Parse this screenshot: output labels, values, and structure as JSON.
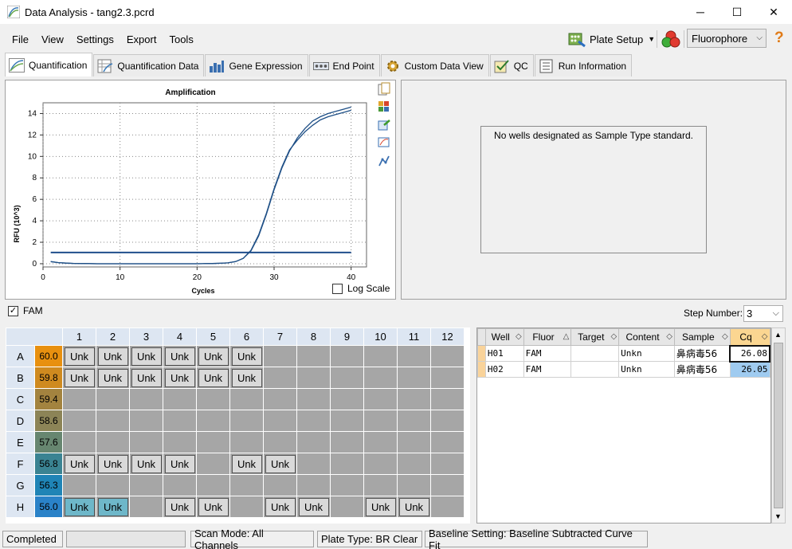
{
  "window": {
    "title": "Data Analysis - tang2.3.pcrd",
    "min": "─",
    "max": "☐",
    "close": "✕"
  },
  "menu": [
    "File",
    "View",
    "Settings",
    "Export",
    "Tools"
  ],
  "toolbar": {
    "plate_setup": "Plate Setup",
    "fluorophore": "Fluorophore",
    "help": "?"
  },
  "tabs": [
    "Quantification",
    "Quantification Data",
    "Gene Expression",
    "End Point",
    "Custom Data View",
    "QC",
    "Run Information"
  ],
  "amplification": {
    "title": "Amplification",
    "xlabel": "Cycles",
    "ylabel": "RFU (10^3)",
    "log_scale_label": "Log Scale",
    "threshold": 1.05,
    "chart_data": {
      "type": "line",
      "title": "Amplification",
      "xlabel": "Cycles",
      "ylabel": "RFU (10^3)",
      "xlim": [
        0,
        42
      ],
      "ylim": [
        -0.3,
        15
      ],
      "xticks": [
        0,
        10,
        20,
        30,
        40
      ],
      "yticks": [
        0,
        2,
        4,
        6,
        8,
        10,
        12,
        14
      ],
      "x": [
        1,
        2,
        3,
        4,
        5,
        6,
        7,
        8,
        9,
        10,
        11,
        12,
        13,
        14,
        15,
        16,
        17,
        18,
        19,
        20,
        21,
        22,
        23,
        24,
        25,
        26,
        27,
        28,
        29,
        30,
        31,
        32,
        33,
        34,
        35,
        36,
        37,
        38,
        39,
        40
      ],
      "series": [
        {
          "values": [
            0.2,
            0.1,
            0.06,
            0.03,
            0.02,
            0.01,
            0,
            0,
            0,
            0,
            0,
            0,
            0,
            0,
            0,
            0,
            0,
            0,
            0,
            0,
            0.01,
            0.02,
            0.04,
            0.08,
            0.2,
            0.5,
            1.2,
            2.6,
            4.6,
            6.9,
            8.9,
            10.5,
            11.7,
            12.6,
            13.3,
            13.7,
            14.0,
            14.2,
            14.4,
            14.6
          ]
        },
        {
          "values": [
            0.2,
            0.1,
            0.06,
            0.03,
            0.02,
            0.01,
            0,
            0,
            0,
            0,
            0,
            0,
            0,
            0,
            0,
            0,
            0,
            0,
            0,
            0,
            0.01,
            0.02,
            0.04,
            0.08,
            0.2,
            0.5,
            1.25,
            2.7,
            4.7,
            7.0,
            9.0,
            10.6,
            11.5,
            12.3,
            12.9,
            13.4,
            13.7,
            13.9,
            14.1,
            14.3
          ]
        }
      ]
    }
  },
  "standard_panel": {
    "message": "No wells designated as Sample Type standard."
  },
  "fam_checkbox": {
    "label": "FAM",
    "checked": true
  },
  "step_number": {
    "label": "Step Number:",
    "value": "3"
  },
  "plate": {
    "columns": [
      "1",
      "2",
      "3",
      "4",
      "5",
      "6",
      "7",
      "8",
      "9",
      "10",
      "11",
      "12"
    ],
    "rows": [
      {
        "label": "A",
        "temp": "60.0",
        "color": "#e8900f",
        "wells": [
          "Unk",
          "Unk",
          "Unk",
          "Unk",
          "Unk",
          "Unk",
          "",
          "",
          "",
          "",
          "",
          ""
        ]
      },
      {
        "label": "B",
        "temp": "59.8",
        "color": "#cf8a1f",
        "wells": [
          "Unk",
          "Unk",
          "Unk",
          "Unk",
          "Unk",
          "Unk",
          "",
          "",
          "",
          "",
          "",
          ""
        ]
      },
      {
        "label": "C",
        "temp": "59.4",
        "color": "#a3833f",
        "wells": [
          "",
          "",
          "",
          "",
          "",
          "",
          "",
          "",
          "",
          "",
          "",
          ""
        ]
      },
      {
        "label": "D",
        "temp": "58.6",
        "color": "#8c8457",
        "wells": [
          "",
          "",
          "",
          "",
          "",
          "",
          "",
          "",
          "",
          "",
          "",
          ""
        ]
      },
      {
        "label": "E",
        "temp": "57.6",
        "color": "#678670",
        "wells": [
          "",
          "",
          "",
          "",
          "",
          "",
          "",
          "",
          "",
          "",
          "",
          ""
        ]
      },
      {
        "label": "F",
        "temp": "56.8",
        "color": "#3a8392",
        "wells": [
          "Unk",
          "Unk",
          "Unk",
          "Unk",
          "",
          "Unk",
          "Unk",
          "",
          "",
          "",
          "",
          ""
        ]
      },
      {
        "label": "G",
        "temp": "56.3",
        "color": "#1f84b6",
        "wells": [
          "",
          "",
          "",
          "",
          "",
          "",
          "",
          "",
          "",
          "",
          "",
          ""
        ]
      },
      {
        "label": "H",
        "temp": "56.0",
        "color": "#2a82c8",
        "wells": [
          "Unk",
          "Unk",
          "",
          "Unk",
          "Unk",
          "",
          "Unk",
          "Unk",
          "",
          "Unk",
          "Unk",
          ""
        ]
      }
    ],
    "selected_wells": [
      "H1",
      "H2"
    ]
  },
  "results": {
    "headers": [
      "Well",
      "Fluor",
      "Target",
      "Content",
      "Sample",
      "Cq"
    ],
    "rows": [
      {
        "well": "H01",
        "fluor": "FAM",
        "target": "",
        "content": "Unkn",
        "sample": "鼻病毒56",
        "cq": "26.08"
      },
      {
        "well": "H02",
        "fluor": "FAM",
        "target": "",
        "content": "Unkn",
        "sample": "鼻病毒56",
        "cq": "26.05"
      }
    ]
  },
  "statusbar": {
    "state": "Completed",
    "scan_mode": "Scan Mode: All Channels",
    "plate_type": "Plate Type: BR Clear",
    "baseline": "Baseline Setting: Baseline Subtracted Curve Fit"
  }
}
